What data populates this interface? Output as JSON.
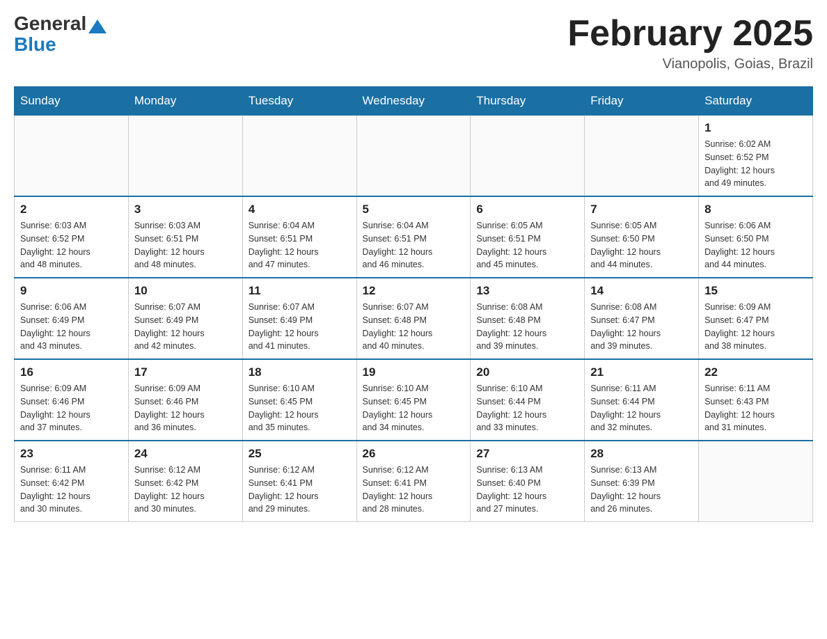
{
  "header": {
    "logo_general": "General",
    "logo_blue": "Blue",
    "month_title": "February 2025",
    "subtitle": "Vianopolis, Goias, Brazil"
  },
  "days_of_week": [
    "Sunday",
    "Monday",
    "Tuesday",
    "Wednesday",
    "Thursday",
    "Friday",
    "Saturday"
  ],
  "weeks": [
    [
      {
        "num": "",
        "info": ""
      },
      {
        "num": "",
        "info": ""
      },
      {
        "num": "",
        "info": ""
      },
      {
        "num": "",
        "info": ""
      },
      {
        "num": "",
        "info": ""
      },
      {
        "num": "",
        "info": ""
      },
      {
        "num": "1",
        "info": "Sunrise: 6:02 AM\nSunset: 6:52 PM\nDaylight: 12 hours\nand 49 minutes."
      }
    ],
    [
      {
        "num": "2",
        "info": "Sunrise: 6:03 AM\nSunset: 6:52 PM\nDaylight: 12 hours\nand 48 minutes."
      },
      {
        "num": "3",
        "info": "Sunrise: 6:03 AM\nSunset: 6:51 PM\nDaylight: 12 hours\nand 48 minutes."
      },
      {
        "num": "4",
        "info": "Sunrise: 6:04 AM\nSunset: 6:51 PM\nDaylight: 12 hours\nand 47 minutes."
      },
      {
        "num": "5",
        "info": "Sunrise: 6:04 AM\nSunset: 6:51 PM\nDaylight: 12 hours\nand 46 minutes."
      },
      {
        "num": "6",
        "info": "Sunrise: 6:05 AM\nSunset: 6:51 PM\nDaylight: 12 hours\nand 45 minutes."
      },
      {
        "num": "7",
        "info": "Sunrise: 6:05 AM\nSunset: 6:50 PM\nDaylight: 12 hours\nand 44 minutes."
      },
      {
        "num": "8",
        "info": "Sunrise: 6:06 AM\nSunset: 6:50 PM\nDaylight: 12 hours\nand 44 minutes."
      }
    ],
    [
      {
        "num": "9",
        "info": "Sunrise: 6:06 AM\nSunset: 6:49 PM\nDaylight: 12 hours\nand 43 minutes."
      },
      {
        "num": "10",
        "info": "Sunrise: 6:07 AM\nSunset: 6:49 PM\nDaylight: 12 hours\nand 42 minutes."
      },
      {
        "num": "11",
        "info": "Sunrise: 6:07 AM\nSunset: 6:49 PM\nDaylight: 12 hours\nand 41 minutes."
      },
      {
        "num": "12",
        "info": "Sunrise: 6:07 AM\nSunset: 6:48 PM\nDaylight: 12 hours\nand 40 minutes."
      },
      {
        "num": "13",
        "info": "Sunrise: 6:08 AM\nSunset: 6:48 PM\nDaylight: 12 hours\nand 39 minutes."
      },
      {
        "num": "14",
        "info": "Sunrise: 6:08 AM\nSunset: 6:47 PM\nDaylight: 12 hours\nand 39 minutes."
      },
      {
        "num": "15",
        "info": "Sunrise: 6:09 AM\nSunset: 6:47 PM\nDaylight: 12 hours\nand 38 minutes."
      }
    ],
    [
      {
        "num": "16",
        "info": "Sunrise: 6:09 AM\nSunset: 6:46 PM\nDaylight: 12 hours\nand 37 minutes."
      },
      {
        "num": "17",
        "info": "Sunrise: 6:09 AM\nSunset: 6:46 PM\nDaylight: 12 hours\nand 36 minutes."
      },
      {
        "num": "18",
        "info": "Sunrise: 6:10 AM\nSunset: 6:45 PM\nDaylight: 12 hours\nand 35 minutes."
      },
      {
        "num": "19",
        "info": "Sunrise: 6:10 AM\nSunset: 6:45 PM\nDaylight: 12 hours\nand 34 minutes."
      },
      {
        "num": "20",
        "info": "Sunrise: 6:10 AM\nSunset: 6:44 PM\nDaylight: 12 hours\nand 33 minutes."
      },
      {
        "num": "21",
        "info": "Sunrise: 6:11 AM\nSunset: 6:44 PM\nDaylight: 12 hours\nand 32 minutes."
      },
      {
        "num": "22",
        "info": "Sunrise: 6:11 AM\nSunset: 6:43 PM\nDaylight: 12 hours\nand 31 minutes."
      }
    ],
    [
      {
        "num": "23",
        "info": "Sunrise: 6:11 AM\nSunset: 6:42 PM\nDaylight: 12 hours\nand 30 minutes."
      },
      {
        "num": "24",
        "info": "Sunrise: 6:12 AM\nSunset: 6:42 PM\nDaylight: 12 hours\nand 30 minutes."
      },
      {
        "num": "25",
        "info": "Sunrise: 6:12 AM\nSunset: 6:41 PM\nDaylight: 12 hours\nand 29 minutes."
      },
      {
        "num": "26",
        "info": "Sunrise: 6:12 AM\nSunset: 6:41 PM\nDaylight: 12 hours\nand 28 minutes."
      },
      {
        "num": "27",
        "info": "Sunrise: 6:13 AM\nSunset: 6:40 PM\nDaylight: 12 hours\nand 27 minutes."
      },
      {
        "num": "28",
        "info": "Sunrise: 6:13 AM\nSunset: 6:39 PM\nDaylight: 12 hours\nand 26 minutes."
      },
      {
        "num": "",
        "info": ""
      }
    ]
  ]
}
